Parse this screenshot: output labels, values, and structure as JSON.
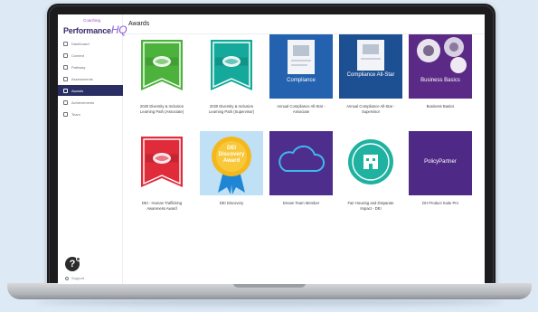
{
  "app": {
    "logo_tagline": "Coaching",
    "logo_main": "Performance",
    "logo_hq": "HQ"
  },
  "sidebar": {
    "items": [
      {
        "label": "Dashboard",
        "icon": "dashboard-icon",
        "active": false
      },
      {
        "label": "Content",
        "icon": "content-icon",
        "active": false
      },
      {
        "label": "Pathway",
        "icon": "pathway-icon",
        "active": false
      },
      {
        "label": "Assessments",
        "icon": "assessments-icon",
        "active": false
      },
      {
        "label": "Awards",
        "icon": "awards-icon",
        "active": true
      },
      {
        "label": "Achievements",
        "icon": "trophy-icon",
        "active": false
      },
      {
        "label": "Team",
        "icon": "team-icon",
        "active": false
      }
    ],
    "help_label": "?",
    "account_label": "Support"
  },
  "page": {
    "title": "Awards"
  },
  "awards": [
    {
      "caption": "2020 Diversity & Inclusion Learning Path (Associate)",
      "thumb_text": "",
      "thumb": "green-ribbon"
    },
    {
      "caption": "2020 Diversity & Inclusion Learning Path (Supervisor)",
      "thumb_text": "",
      "thumb": "teal-ribbon"
    },
    {
      "caption": "Annual Compliance All-Star - Associate",
      "thumb_text": "Compliance",
      "thumb": "compliance-blue"
    },
    {
      "caption": "Annual Compliance All-Star - Supervisor",
      "thumb_text": "Compliance All-Star",
      "thumb": "compliance-navy"
    },
    {
      "caption": "Business Basics",
      "thumb_text": "Business Basics",
      "thumb": "business-purple"
    },
    {
      "caption": "DEI - Human Trafficking Awareness Award",
      "thumb_text": "",
      "thumb": "red-ribbon"
    },
    {
      "caption": "DEI Discovery",
      "thumb_text": "DEI Discovery Award",
      "thumb": "gold-medal"
    },
    {
      "caption": "Dream Team Member",
      "thumb_text": "",
      "thumb": "cloud-purple"
    },
    {
      "caption": "Fair Housing and Disparate Impact - DEI",
      "thumb_text": "",
      "thumb": "teal-badge"
    },
    {
      "caption": "DH Product Suite Pro",
      "thumb_text": "PolicyPartner",
      "thumb": "policy-purple"
    }
  ],
  "colors": {
    "sidebar_active": "#2a2f63",
    "background": "#dde9f4"
  }
}
